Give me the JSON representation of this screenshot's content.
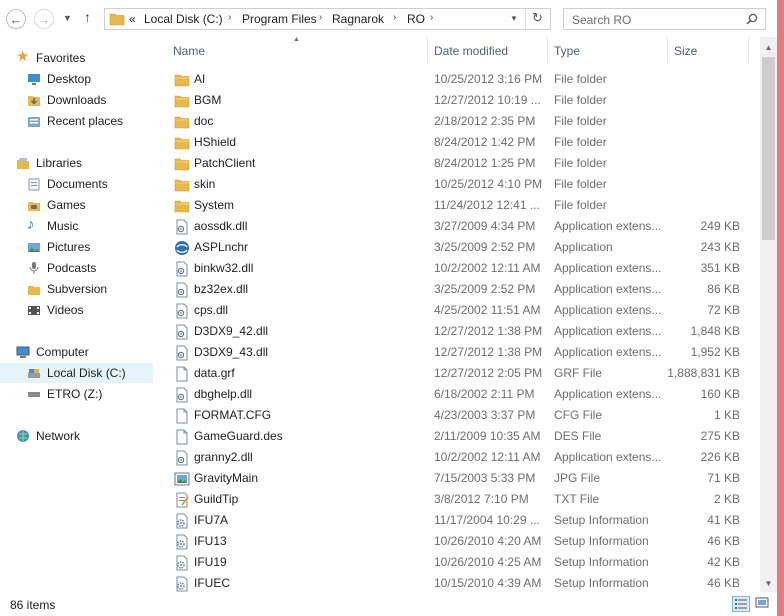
{
  "address": {
    "overflow": "«",
    "segments": [
      "Local Disk (C:)",
      "Program Files",
      "Ragnarok",
      "RO"
    ]
  },
  "search": {
    "placeholder": "Search RO"
  },
  "nav": {
    "favorites": {
      "label": "Favorites",
      "items": [
        "Desktop",
        "Downloads",
        "Recent places"
      ]
    },
    "libraries": {
      "label": "Libraries",
      "items": [
        "Documents",
        "Games",
        "Music",
        "Pictures",
        "Podcasts",
        "Subversion",
        "Videos"
      ]
    },
    "computer": {
      "label": "Computer",
      "items": [
        "Local Disk (C:)",
        "ETRO (Z:)"
      ]
    },
    "network": {
      "label": "Network"
    }
  },
  "columns": {
    "name": "Name",
    "date": "Date modified",
    "type": "Type",
    "size": "Size"
  },
  "files": [
    {
      "name": "AI",
      "date": "10/25/2012 3:16 PM",
      "type": "File folder",
      "size": "",
      "icon": "folder"
    },
    {
      "name": "BGM",
      "date": "12/27/2012 10:19 ...",
      "type": "File folder",
      "size": "",
      "icon": "folder"
    },
    {
      "name": "doc",
      "date": "2/18/2012 2:35 PM",
      "type": "File folder",
      "size": "",
      "icon": "folder"
    },
    {
      "name": "HShield",
      "date": "8/24/2012 1:42 PM",
      "type": "File folder",
      "size": "",
      "icon": "folder"
    },
    {
      "name": "PatchClient",
      "date": "8/24/2012 1:25 PM",
      "type": "File folder",
      "size": "",
      "icon": "folder"
    },
    {
      "name": "skin",
      "date": "10/25/2012 4:10 PM",
      "type": "File folder",
      "size": "",
      "icon": "folder"
    },
    {
      "name": "System",
      "date": "11/24/2012 12:41 ...",
      "type": "File folder",
      "size": "",
      "icon": "folder"
    },
    {
      "name": "aossdk.dll",
      "date": "3/27/2009 4:34 PM",
      "type": "Application extens...",
      "size": "249 KB",
      "icon": "dll"
    },
    {
      "name": "ASPLnchr",
      "date": "3/25/2009 2:52 PM",
      "type": "Application",
      "size": "243 KB",
      "icon": "app"
    },
    {
      "name": "binkw32.dll",
      "date": "10/2/2002 12:11 AM",
      "type": "Application extens...",
      "size": "351 KB",
      "icon": "dll"
    },
    {
      "name": "bz32ex.dll",
      "date": "3/25/2009 2:52 PM",
      "type": "Application extens...",
      "size": "86 KB",
      "icon": "dll"
    },
    {
      "name": "cps.dll",
      "date": "4/25/2002 11:51 AM",
      "type": "Application extens...",
      "size": "72 KB",
      "icon": "dll"
    },
    {
      "name": "D3DX9_42.dll",
      "date": "12/27/2012 1:38 PM",
      "type": "Application extens...",
      "size": "1,848 KB",
      "icon": "dll"
    },
    {
      "name": "D3DX9_43.dll",
      "date": "12/27/2012 1:38 PM",
      "type": "Application extens...",
      "size": "1,952 KB",
      "icon": "dll"
    },
    {
      "name": "data.grf",
      "date": "12/27/2012 2:05 PM",
      "type": "GRF File",
      "size": "1,888,831 KB",
      "icon": "file"
    },
    {
      "name": "dbghelp.dll",
      "date": "6/18/2002 2:11 PM",
      "type": "Application extens...",
      "size": "160 KB",
      "icon": "dll"
    },
    {
      "name": "FORMAT.CFG",
      "date": "4/23/2003 3:37 PM",
      "type": "CFG File",
      "size": "1 KB",
      "icon": "file"
    },
    {
      "name": "GameGuard.des",
      "date": "2/11/2009 10:35 AM",
      "type": "DES File",
      "size": "275 KB",
      "icon": "file"
    },
    {
      "name": "granny2.dll",
      "date": "10/2/2002 12:11 AM",
      "type": "Application extens...",
      "size": "226 KB",
      "icon": "dll"
    },
    {
      "name": "GravityMain",
      "date": "7/15/2003 5:33 PM",
      "type": "JPG File",
      "size": "71 KB",
      "icon": "image"
    },
    {
      "name": "GuildTip",
      "date": "3/8/2012 7:10 PM",
      "type": "TXT File",
      "size": "2 KB",
      "icon": "text"
    },
    {
      "name": "IFU7A",
      "date": "11/17/2004 10:29 ...",
      "type": "Setup Information",
      "size": "41 KB",
      "icon": "setup"
    },
    {
      "name": "IFU13",
      "date": "10/26/2010 4:20 AM",
      "type": "Setup Information",
      "size": "46 KB",
      "icon": "setup"
    },
    {
      "name": "IFU19",
      "date": "10/26/2010 4:25 AM",
      "type": "Setup Information",
      "size": "42 KB",
      "icon": "setup"
    },
    {
      "name": "IFUEC",
      "date": "10/15/2010 4:39 AM",
      "type": "Setup Information",
      "size": "46 KB",
      "icon": "setup"
    }
  ],
  "status": {
    "count": "86 items"
  },
  "colors": {
    "folder": "#e8b94a",
    "selection": "#e5f3fb",
    "header_text": "#4c607a",
    "accent_bar": "#e07d7f"
  }
}
